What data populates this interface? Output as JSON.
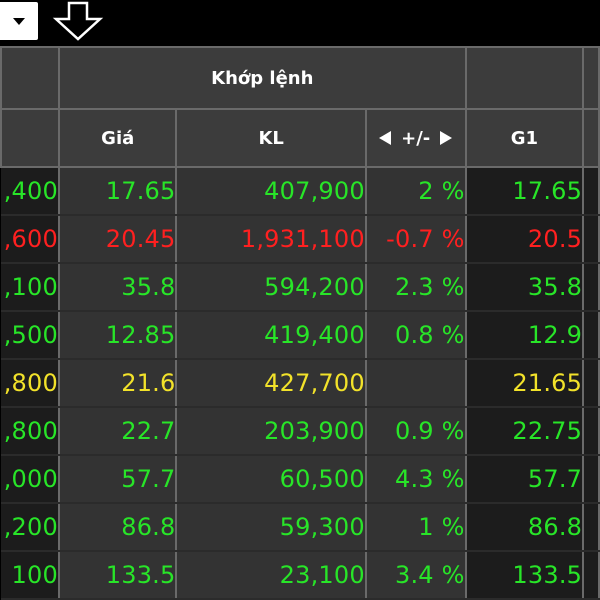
{
  "toolbar": {
    "dropdown_icon": "chevron-down-icon",
    "scroll_down_icon": "arrow-down-outline-icon"
  },
  "table": {
    "group_header": "Khớp lệnh",
    "columns": {
      "price": "Giá",
      "volume": "KL",
      "change": "+/-",
      "g1": "G1"
    },
    "rows": [
      {
        "prev": ",400",
        "price": "17.65",
        "volume": "407,900",
        "change": "2 %",
        "g1": "17.65",
        "color": "green"
      },
      {
        "prev": ",600",
        "price": "20.45",
        "volume": "1,931,100",
        "change": "-0.7 %",
        "g1": "20.5",
        "color": "red"
      },
      {
        "prev": ",100",
        "price": "35.8",
        "volume": "594,200",
        "change": "2.3 %",
        "g1": "35.8",
        "color": "green"
      },
      {
        "prev": ",500",
        "price": "12.85",
        "volume": "419,400",
        "change": "0.8 %",
        "g1": "12.9",
        "color": "green"
      },
      {
        "prev": ",800",
        "price": "21.6",
        "volume": "427,700",
        "change": "",
        "g1": "21.65",
        "color": "yellow"
      },
      {
        "prev": ",800",
        "price": "22.7",
        "volume": "203,900",
        "change": "0.9 %",
        "g1": "22.75",
        "color": "green"
      },
      {
        "prev": ",000",
        "price": "57.7",
        "volume": "60,500",
        "change": "4.3 %",
        "g1": "57.7",
        "color": "green"
      },
      {
        "prev": ",200",
        "price": "86.8",
        "volume": "59,300",
        "change": "1 %",
        "g1": "86.8",
        "color": "green"
      },
      {
        "prev": "100",
        "price": "133.5",
        "volume": "23,100",
        "change": "3.4 %",
        "g1": "133.5",
        "color": "green"
      }
    ]
  },
  "colors": {
    "up": "#28e528",
    "down": "#ff2020",
    "reference": "#f2e22a",
    "header_bg": "#3c3c3c",
    "cell_dark": "#1c1c1c",
    "cell_mid": "#333333"
  }
}
